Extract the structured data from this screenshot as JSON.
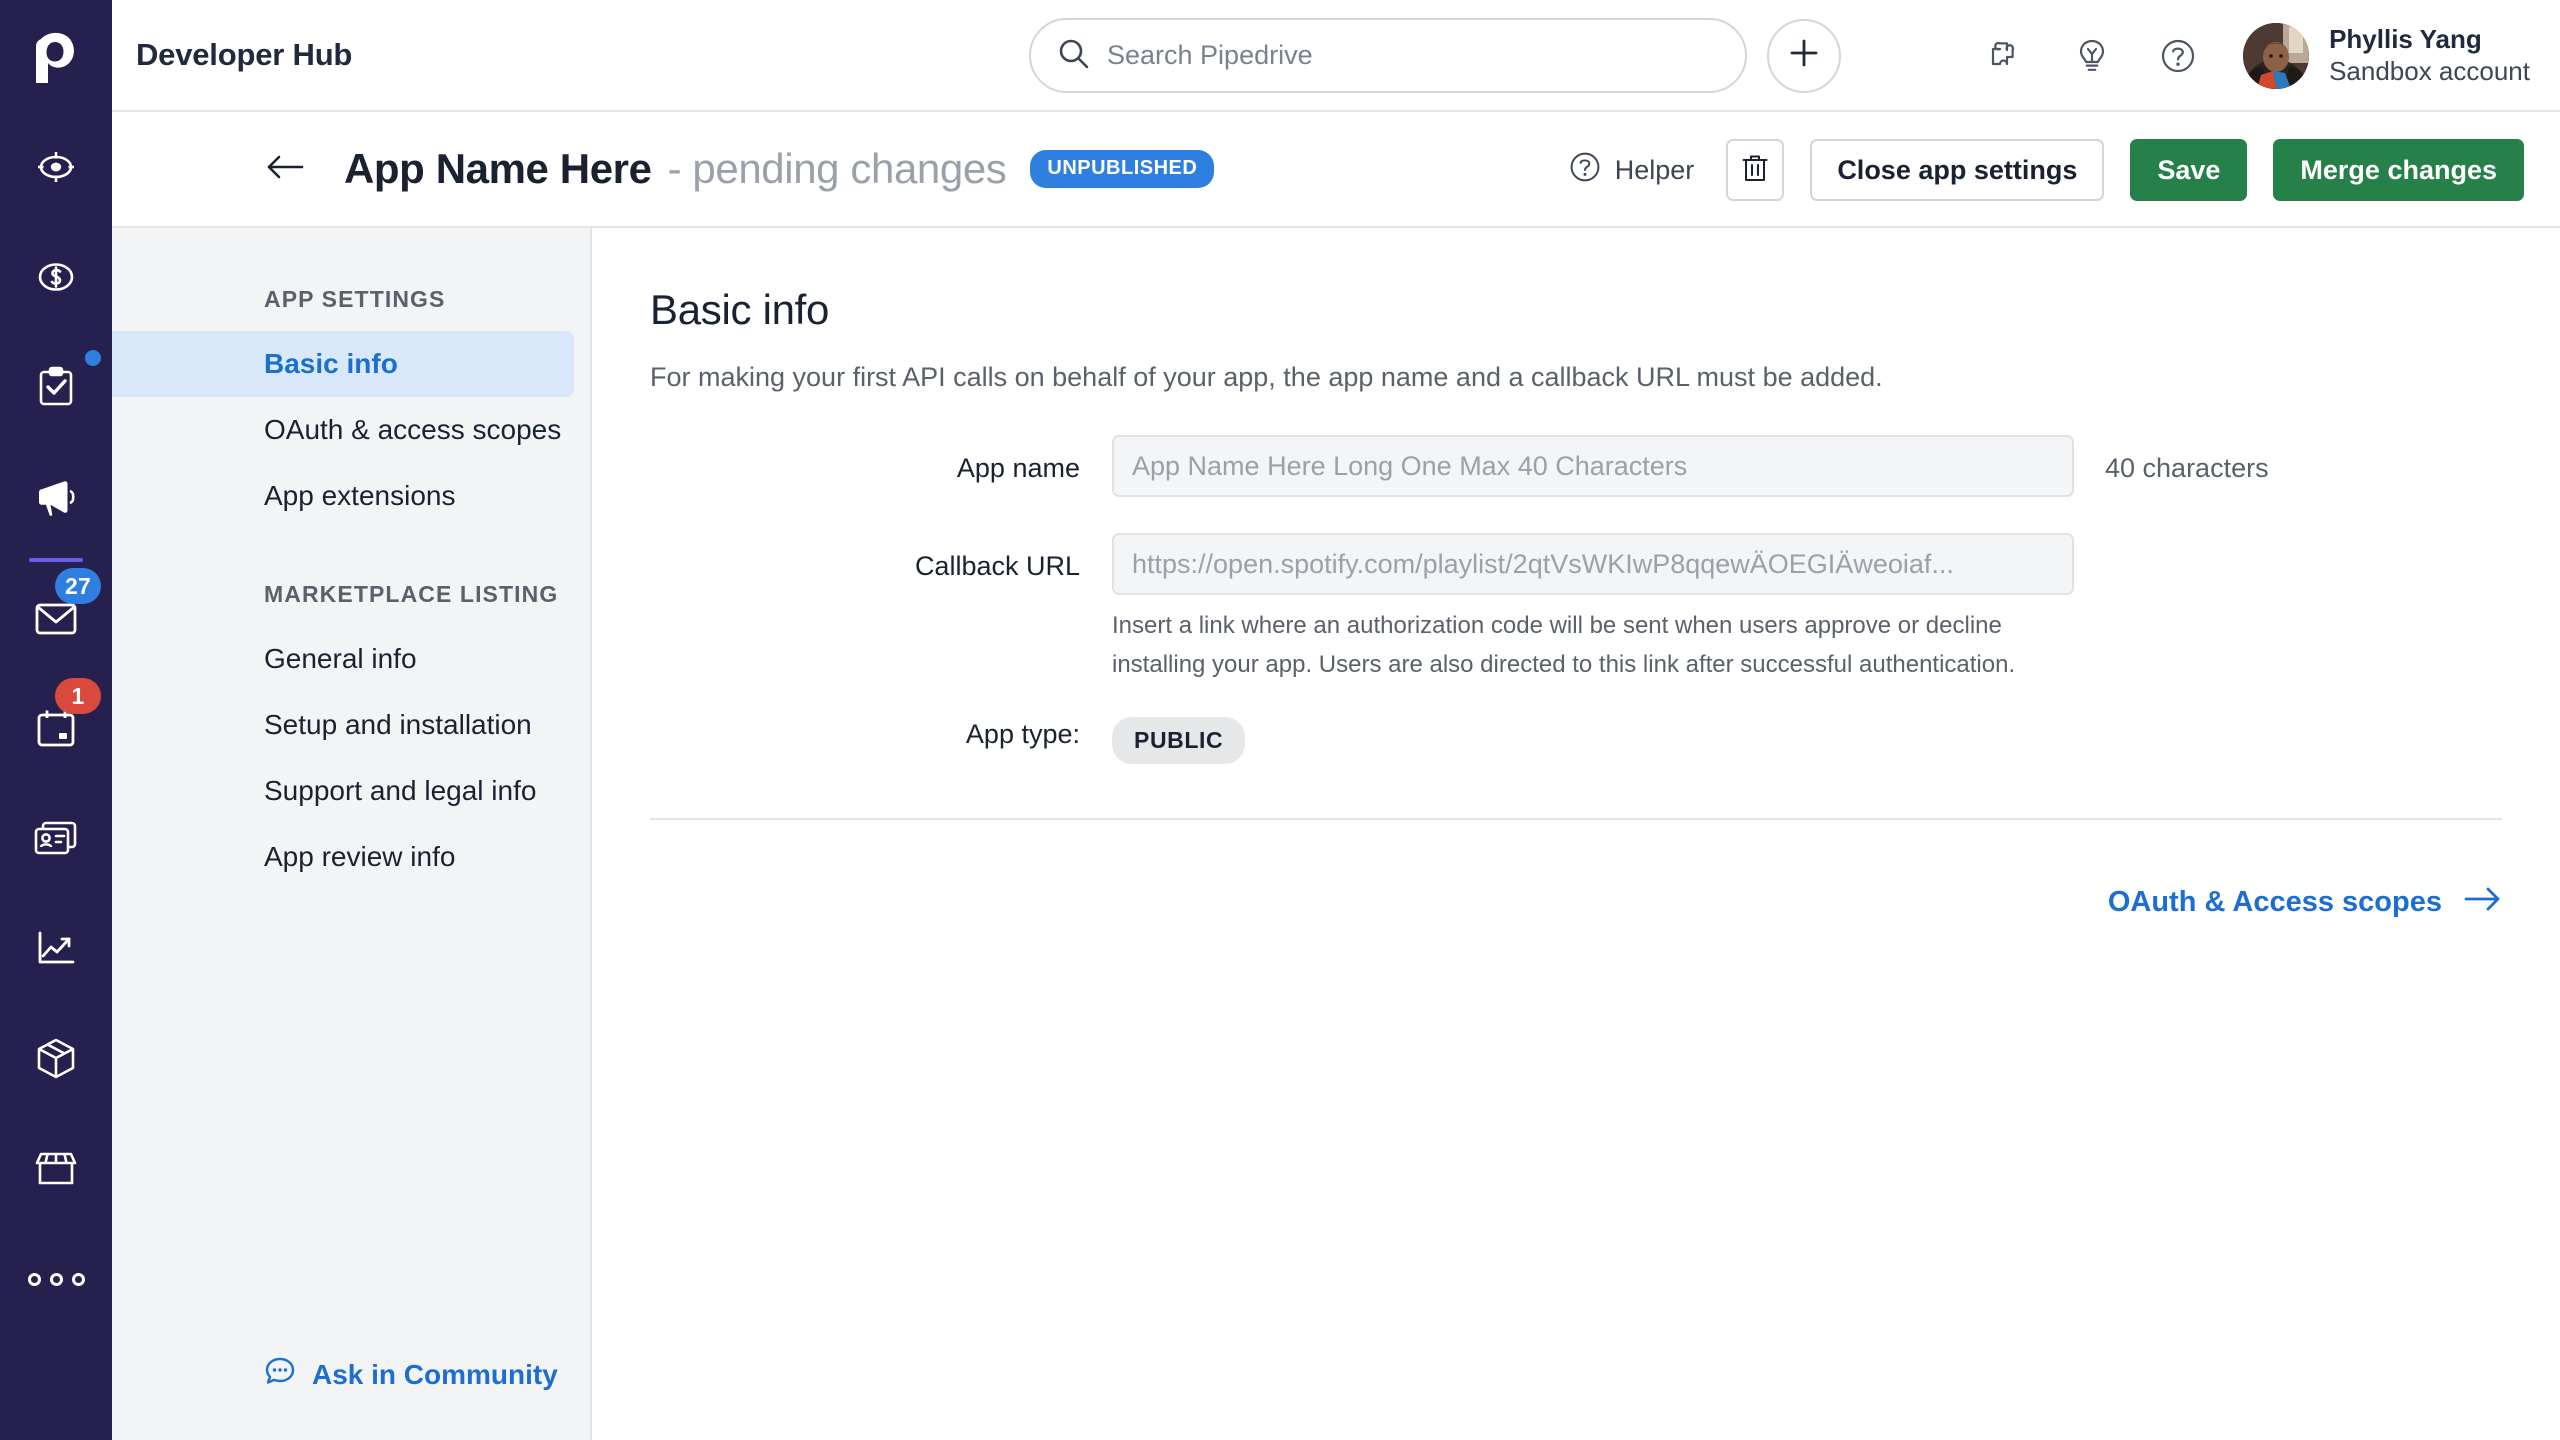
{
  "rail": {
    "logo_icon": "pipedrive-logo",
    "items": [
      {
        "icon": "leads-target-icon",
        "name": "leads"
      },
      {
        "icon": "deals-dollar-icon",
        "name": "deals"
      },
      {
        "icon": "activities-clipboard-icon",
        "name": "activities",
        "dot": true
      },
      {
        "icon": "campaigns-megaphone-icon",
        "name": "campaigns"
      },
      {
        "icon": "mail-envelope-icon",
        "name": "mail",
        "badge": "27",
        "badge_color": "#2f7fe0"
      },
      {
        "icon": "calendar-icon",
        "name": "calendar",
        "badge": "1",
        "badge_color": "#d94a3d"
      },
      {
        "icon": "contacts-card-icon",
        "name": "contacts"
      },
      {
        "icon": "insights-chart-icon",
        "name": "insights"
      },
      {
        "icon": "products-box-icon",
        "name": "products"
      },
      {
        "icon": "marketplace-store-icon",
        "name": "marketplace"
      }
    ],
    "more_label": "more"
  },
  "topbar": {
    "title": "Developer Hub",
    "search": {
      "placeholder": "Search Pipedrive",
      "value": "",
      "icon": "search-icon"
    },
    "add_button_icon": "plus-icon",
    "icons": [
      {
        "name": "puzzle-icon"
      },
      {
        "name": "lightbulb-icon"
      },
      {
        "name": "help-circle-icon"
      }
    ],
    "user": {
      "name": "Phyllis Yang",
      "account": "Sandbox account"
    }
  },
  "pagehead": {
    "back_icon": "arrow-left-icon",
    "app_name": "App Name Here",
    "pending_text": "- pending changes",
    "status_badge": "UNPUBLISHED",
    "status_badge_color": "#2f7fe0",
    "helper_label": "Helper",
    "helper_icon": "help-circle-icon",
    "delete_icon": "trash-icon",
    "close_label": "Close app settings",
    "save_label": "Save",
    "merge_label": "Merge changes",
    "primary_color": "#25804a"
  },
  "sidebar": {
    "section_app_settings": "APP SETTINGS",
    "app_settings_items": [
      {
        "label": "Basic info",
        "active": true
      },
      {
        "label": "OAuth & access scopes",
        "active": false
      },
      {
        "label": "App extensions",
        "active": false
      }
    ],
    "section_marketplace": "MARKETPLACE LISTING",
    "marketplace_items": [
      {
        "label": "General info",
        "active": false
      },
      {
        "label": "Setup and installation",
        "active": false
      },
      {
        "label": "Support and legal info",
        "active": false
      },
      {
        "label": "App review info",
        "active": false
      }
    ],
    "community_label": "Ask in Community",
    "community_icon": "chat-bubble-icon",
    "link_color": "#1c6fd0"
  },
  "main": {
    "heading": "Basic info",
    "description": "For making your first API calls on behalf of your app, the app name and a callback URL must be added.",
    "app_name_label": "App name",
    "app_name_value": "",
    "app_name_placeholder": "App Name Here Long One Max 40 Characters",
    "app_name_counter": "40 characters",
    "callback_label": "Callback URL",
    "callback_value": "",
    "callback_placeholder": "https://open.spotify.com/playlist/2qtVsWKIwP8qqewÄOEGIÄweoiaf...",
    "callback_hint": "Insert a link where an authorization code will be sent when users approve or decline installing your app. Users are also directed to this link after successful authentication.",
    "app_type_label": "App type:",
    "app_type_value": "PUBLIC",
    "footer_link_label": "OAuth & Access scopes",
    "footer_link_icon": "arrow-right-icon"
  }
}
